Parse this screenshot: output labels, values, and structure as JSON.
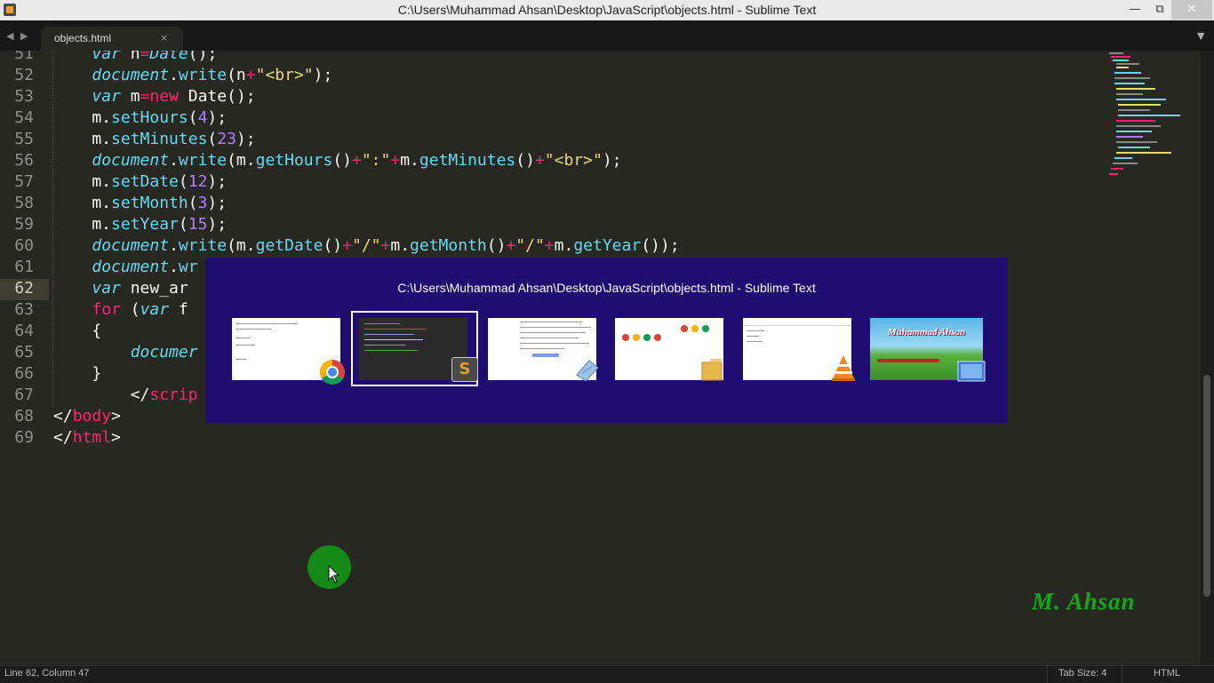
{
  "window": {
    "title": "C:\\Users\\Muhammad Ahsan\\Desktop\\JavaScript\\objects.html - Sublime Text",
    "min_glyph": "—",
    "max_glyph": "⧉",
    "close_glyph": "✕"
  },
  "tabbar": {
    "back_glyph": "◀",
    "forward_glyph": "▶",
    "tab_label": "objects.html",
    "tab_close_glyph": "×",
    "menu_glyph": "▼"
  },
  "editor": {
    "current_line": 62,
    "line_numbers": [
      "51",
      "52",
      "53",
      "54",
      "55",
      "56",
      "57",
      "58",
      "59",
      "60",
      "61",
      "62",
      "63",
      "64",
      "65",
      "66",
      "67",
      "68",
      "69"
    ]
  },
  "switcher": {
    "title": "C:\\Users\\Muhammad Ahsan\\Desktop\\JavaScript\\objects.html - Sublime Text",
    "selected_index": 1,
    "apps": [
      {
        "icon": "chrome-icon"
      },
      {
        "icon": "sublime-text-icon",
        "glyph": "S"
      },
      {
        "icon": "notepad-icon"
      },
      {
        "icon": "folder-icon"
      },
      {
        "icon": "vlc-icon"
      },
      {
        "icon": "desktop-icon",
        "text": "Muhammad Ahsan"
      }
    ]
  },
  "watermark": "M. Ahsan",
  "status": {
    "position": "Line 62, Column 47",
    "tab_size": "Tab Size: 4",
    "syntax": "HTML"
  },
  "colors": {
    "editor_bg": "#272822",
    "switcher_bg": "#1f0d72",
    "keyword": "#f92672",
    "function": "#66d9ef",
    "string": "#e6db74",
    "number": "#ae81ff"
  }
}
